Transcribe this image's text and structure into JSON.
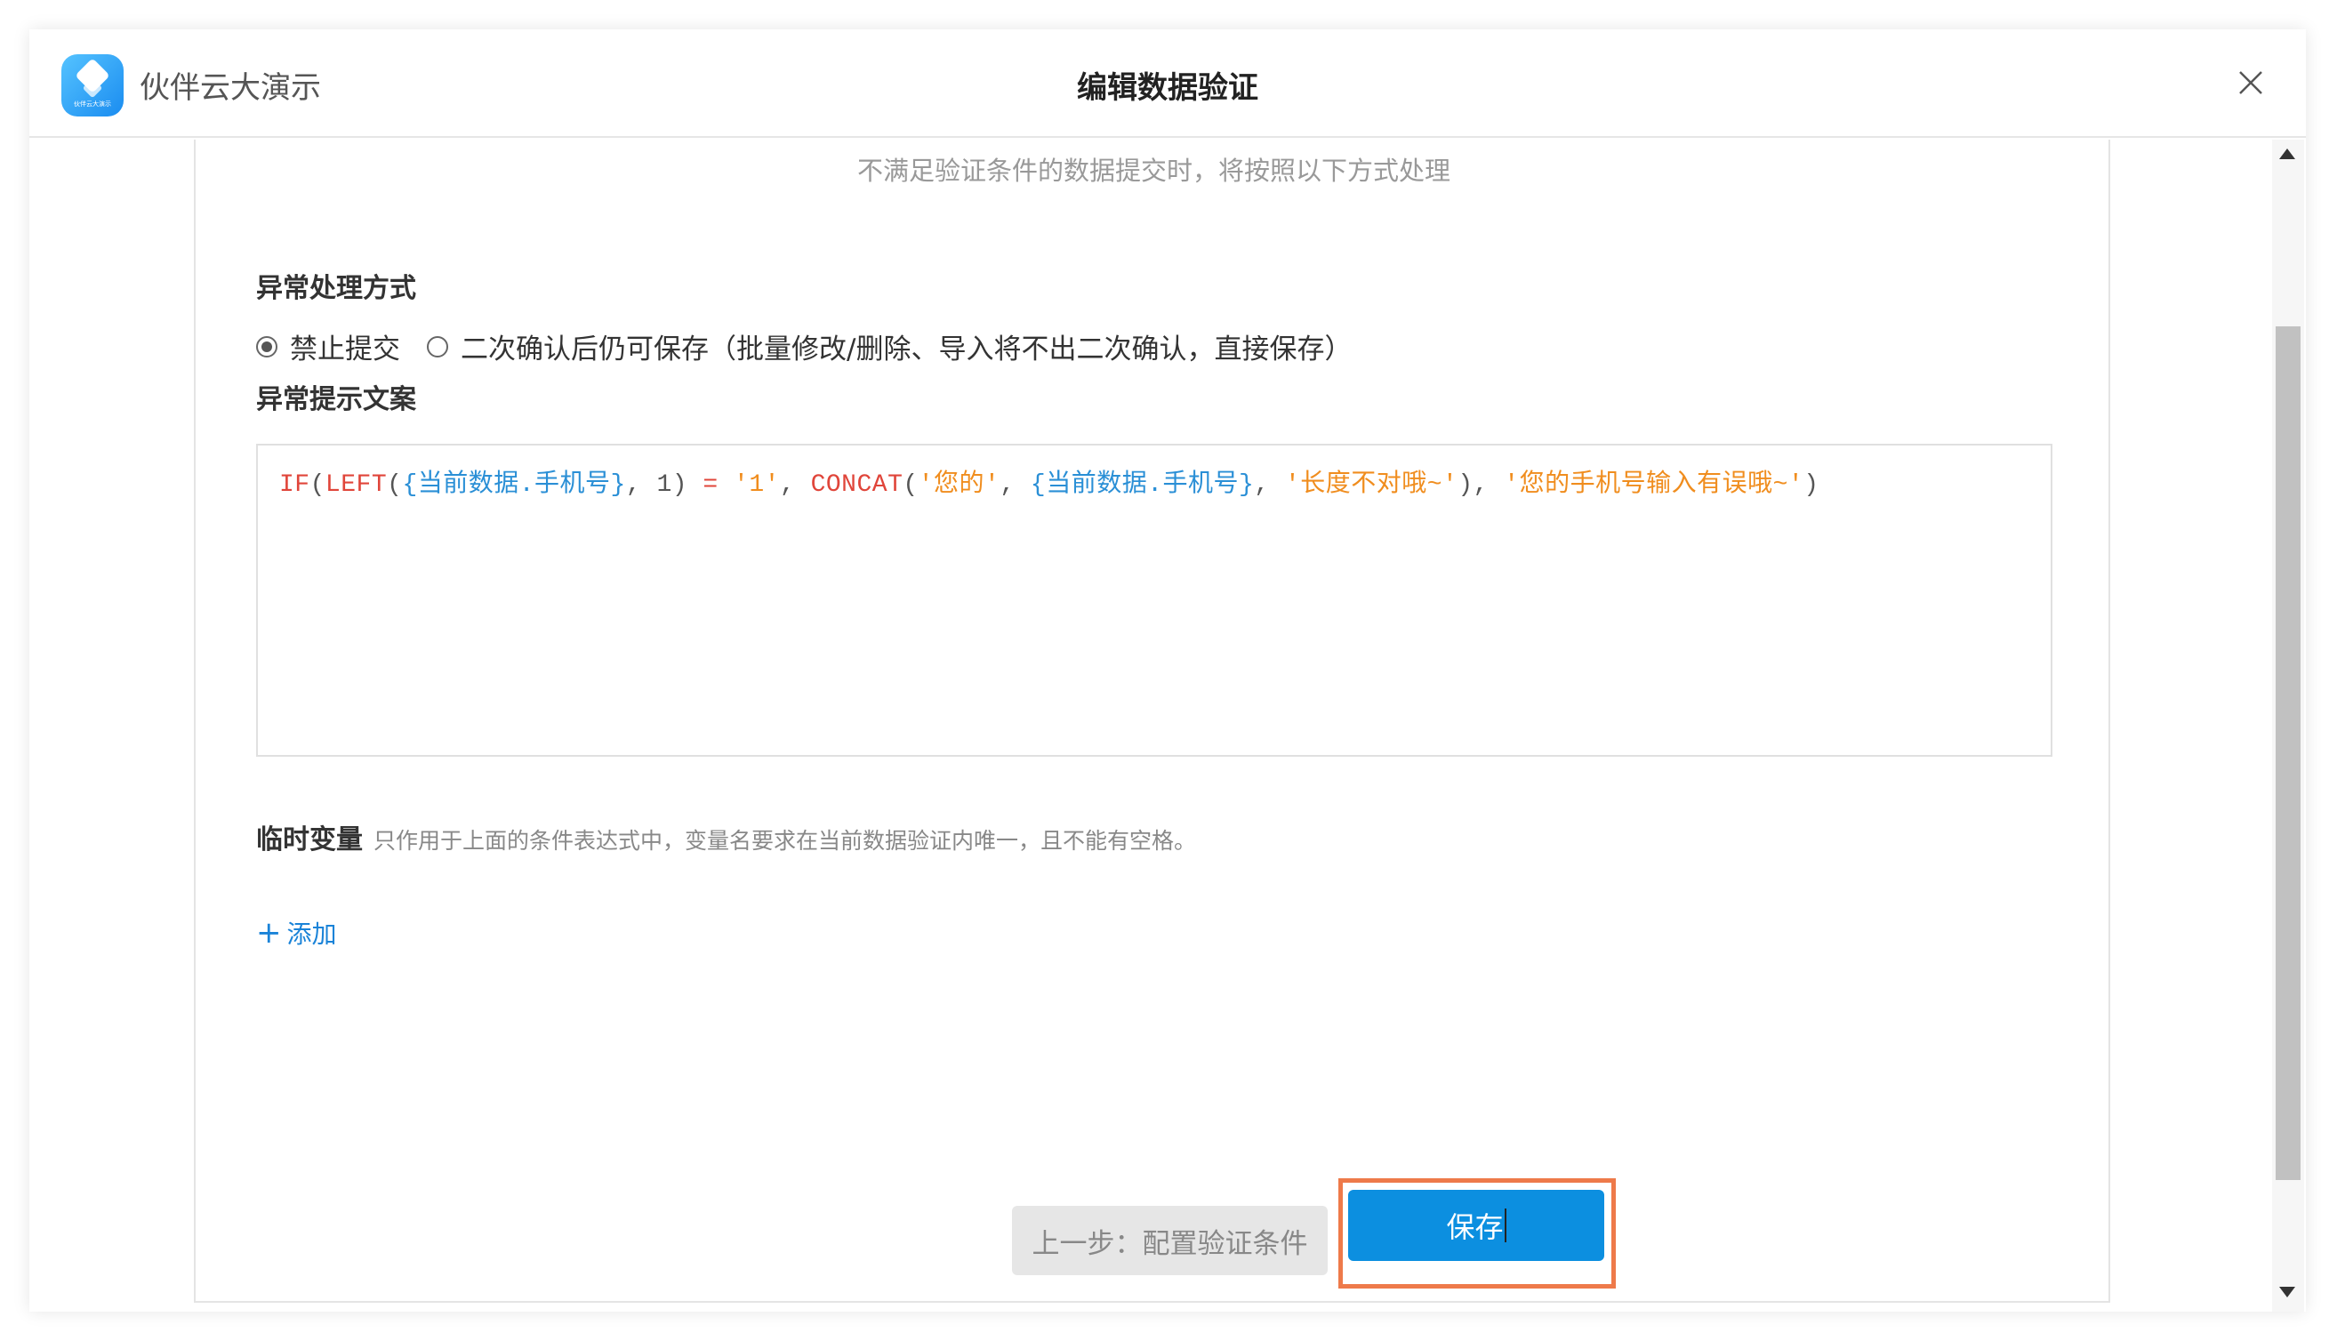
{
  "titlebar": {
    "app_name": "伙伴云大演示",
    "logo_text": "伙伴云大演示",
    "dialog_title": "编辑数据验证"
  },
  "content": {
    "hint": "不满足验证条件的数据提交时，将按照以下方式处理",
    "handling_label": "异常处理方式",
    "options": [
      {
        "label": "禁止提交",
        "checked": true
      },
      {
        "label": "二次确认后仍可保存（批量修改/删除、导入将不出二次确认，直接保存）",
        "checked": false
      }
    ],
    "message_label": "异常提示文案",
    "formula": {
      "t0": "IF",
      "t1": "(",
      "t2": "LEFT",
      "t3": "(",
      "t4": "{当前数据.手机号}",
      "t5": ", ",
      "t6": "1",
      "t7": ") ",
      "t8": "=",
      "t9": " ",
      "t10": "'1'",
      "t11": ", ",
      "t12": "CONCAT",
      "t13": "(",
      "t14": "'您的'",
      "t15": ", ",
      "t16": "{当前数据.手机号}",
      "t17": ", ",
      "t18": "'长度不对哦~'",
      "t19": "), ",
      "t20": "'您的手机号输入有误哦~'",
      "t21": ")"
    },
    "vars_label": "临时变量",
    "vars_desc": "只作用于上面的条件表达式中，变量名要求在当前数据验证内唯一，且不能有空格。",
    "add_link_icon": "+",
    "add_link_label": "添加"
  },
  "footer": {
    "prev_label": "上一步：配置验证条件",
    "save_label": "保存"
  },
  "colors": {
    "primary": "#0c8fe0",
    "highlight": "#ee7a4a",
    "fn": "#e0453a",
    "ref": "#2a8fd6",
    "string": "#f08d1e"
  },
  "icons": {
    "logo": "app-logo-icon",
    "close": "close-icon",
    "add": "plus-icon",
    "scroll_up": "arrow-up-icon",
    "scroll_down": "arrow-down-icon"
  }
}
